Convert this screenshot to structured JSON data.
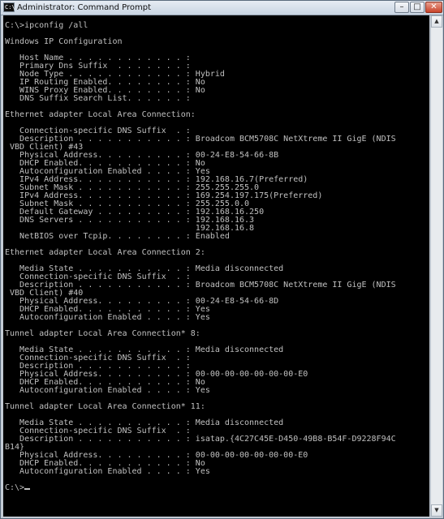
{
  "window": {
    "title": "Administrator: Command Prompt",
    "app_icon_text": "C:\\",
    "minimize_glyph": "–",
    "maximize_glyph": "□",
    "close_glyph": "✕"
  },
  "scrollbar": {
    "up_glyph": "▲",
    "down_glyph": "▼"
  },
  "console": {
    "lines": [
      "C:\\>ipconfig /all",
      "",
      "Windows IP Configuration",
      "",
      "   Host Name . . . . . . . . . . . . :",
      "   Primary Dns Suffix  . . . . . . . :",
      "   Node Type . . . . . . . . . . . . : Hybrid",
      "   IP Routing Enabled. . . . . . . . : No",
      "   WINS Proxy Enabled. . . . . . . . : No",
      "   DNS Suffix Search List. . . . . . :",
      "",
      "Ethernet adapter Local Area Connection:",
      "",
      "   Connection-specific DNS Suffix  . :",
      "   Description . . . . . . . . . . . : Broadcom BCM5708C NetXtreme II GigE (NDIS",
      " VBD Client) #43",
      "   Physical Address. . . . . . . . . : 00-24-E8-54-66-8B",
      "   DHCP Enabled. . . . . . . . . . . : No",
      "   Autoconfiguration Enabled . . . . : Yes",
      "   IPv4 Address. . . . . . . . . . . : 192.168.16.7(Preferred)",
      "   Subnet Mask . . . . . . . . . . . : 255.255.255.0",
      "   IPv4 Address. . . . . . . . . . . : 169.254.197.175(Preferred)",
      "   Subnet Mask . . . . . . . . . . . : 255.255.0.0",
      "   Default Gateway . . . . . . . . . : 192.168.16.250",
      "   DNS Servers . . . . . . . . . . . : 192.168.16.3",
      "                                       192.168.16.8",
      "   NetBIOS over Tcpip. . . . . . . . : Enabled",
      "",
      "Ethernet adapter Local Area Connection 2:",
      "",
      "   Media State . . . . . . . . . . . : Media disconnected",
      "   Connection-specific DNS Suffix  . :",
      "   Description . . . . . . . . . . . : Broadcom BCM5708C NetXtreme II GigE (NDIS",
      " VBD Client) #40",
      "   Physical Address. . . . . . . . . : 00-24-E8-54-66-8D",
      "   DHCP Enabled. . . . . . . . . . . : Yes",
      "   Autoconfiguration Enabled . . . . : Yes",
      "",
      "Tunnel adapter Local Area Connection* 8:",
      "",
      "   Media State . . . . . . . . . . . : Media disconnected",
      "   Connection-specific DNS Suffix  . :",
      "   Description . . . . . . . . . . . :",
      "   Physical Address. . . . . . . . . : 00-00-00-00-00-00-00-E0",
      "   DHCP Enabled. . . . . . . . . . . : No",
      "   Autoconfiguration Enabled . . . . : Yes",
      "",
      "Tunnel adapter Local Area Connection* 11:",
      "",
      "   Media State . . . . . . . . . . . : Media disconnected",
      "   Connection-specific DNS Suffix  . :",
      "   Description . . . . . . . . . . . : isatap.{4C27C45E-D450-49B8-B54F-D9228F94C",
      "B14}",
      "   Physical Address. . . . . . . . . : 00-00-00-00-00-00-00-E0",
      "   DHCP Enabled. . . . . . . . . . . : No",
      "   Autoconfiguration Enabled . . . . : Yes",
      "",
      "C:\\>"
    ]
  }
}
